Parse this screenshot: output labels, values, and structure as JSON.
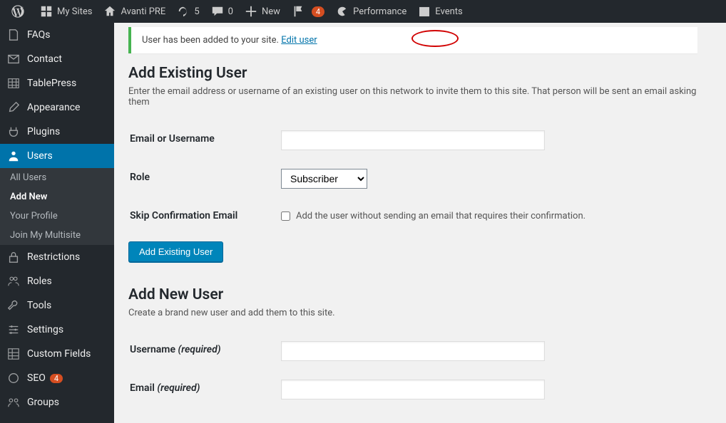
{
  "adminbar": {
    "mysites": "My Sites",
    "sitename": "Avanti PRE",
    "updates": "5",
    "comments": "0",
    "new": "New",
    "notif_count": "4",
    "performance": "Performance",
    "events": "Events"
  },
  "sidebar": {
    "faqs": "FAQs",
    "contact": "Contact",
    "tablepress": "TablePress",
    "appearance": "Appearance",
    "plugins": "Plugins",
    "users": "Users",
    "users_sub": {
      "all": "All Users",
      "add": "Add New",
      "profile": "Your Profile",
      "join": "Join My Multisite"
    },
    "restrictions": "Restrictions",
    "roles": "Roles",
    "tools": "Tools",
    "settings": "Settings",
    "custom_fields": "Custom Fields",
    "seo": "SEO",
    "seo_count": "4",
    "groups": "Groups"
  },
  "notice": {
    "text": "User has been added to your site.",
    "link": "Edit user"
  },
  "existing": {
    "heading": "Add Existing User",
    "desc": "Enter the email address or username of an existing user on this network to invite them to this site. That person will be sent an email asking them",
    "email_label": "Email or Username",
    "role_label": "Role",
    "role_value": "Subscriber",
    "skip_label": "Skip Confirmation Email",
    "skip_desc": "Add the user without sending an email that requires their confirmation.",
    "button": "Add Existing User"
  },
  "newuser": {
    "heading": "Add New User",
    "desc": "Create a brand new user and add them to this site.",
    "username_label": "Username",
    "email_label": "Email",
    "required": "(required)"
  }
}
